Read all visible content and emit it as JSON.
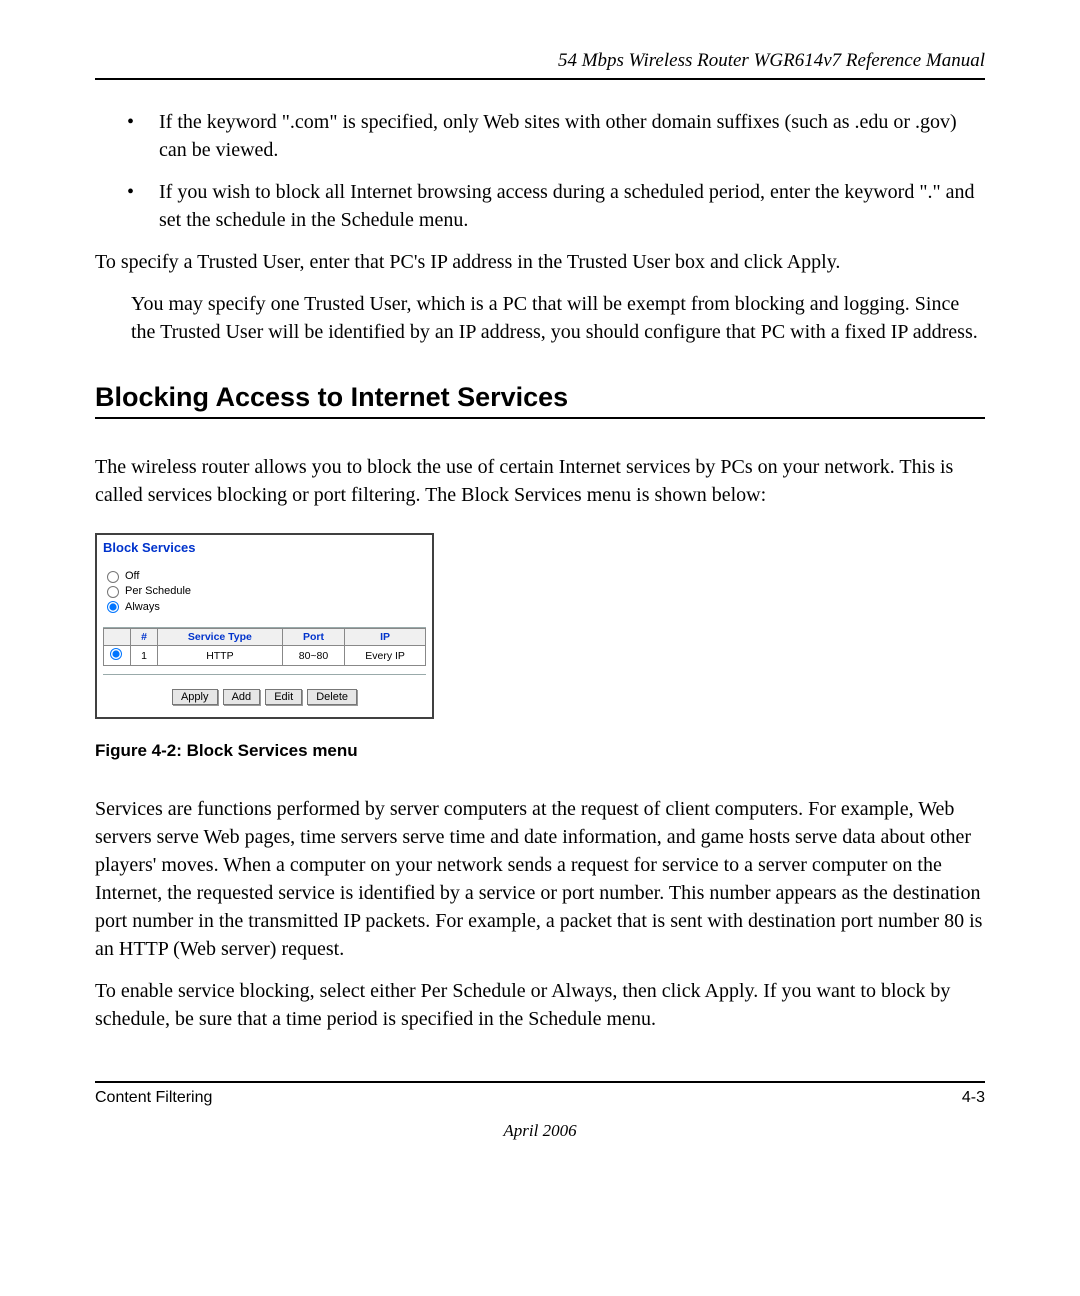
{
  "header": {
    "running_head": "54 Mbps Wireless Router WGR614v7 Reference Manual"
  },
  "bullets": [
    "If the keyword \".com\" is specified, only Web sites with other domain suffixes (such as .edu or .gov) can be viewed.",
    "If you wish to block all Internet browsing access during a scheduled period, enter the keyword \".\" and set the schedule in the Schedule menu."
  ],
  "paras": {
    "trusted_intro": "To specify a Trusted User, enter that PC's IP address in the Trusted User box and click Apply.",
    "trusted_detail": "You may specify one Trusted User, which is a PC that will be exempt from blocking and logging. Since the Trusted User will be identified by an IP address, you should configure that PC with a fixed IP address.",
    "section_heading": "Blocking Access to Internet Services",
    "section_intro": "The wireless router allows you to block the use of certain Internet services by PCs on your network. This is called services blocking or port filtering. The Block Services menu is shown below:",
    "services_para": "Services are functions performed by server computers at the request of client computers. For example, Web servers serve Web pages, time servers serve time and date information, and game hosts serve data about other players' moves. When a computer on your network sends a request for service to a server computer on the Internet, the requested service is identified by a service or port number. This number appears as the destination port number in the transmitted IP packets. For example, a packet that is sent with destination port number 80 is an HTTP (Web server) request.",
    "enable_para": "To enable service blocking, select either Per Schedule or Always, then click Apply. If you want to block by schedule, be sure that a time period is specified in the Schedule menu."
  },
  "screenshot": {
    "title": "Block Services",
    "radios": {
      "off": "Off",
      "per_schedule": "Per Schedule",
      "always": "Always"
    },
    "table": {
      "headers": {
        "num": "#",
        "service_type": "Service Type",
        "port": "Port",
        "ip": "IP"
      },
      "row": {
        "num": "1",
        "service_type": "HTTP",
        "port": "80~80",
        "ip": "Every IP"
      }
    },
    "buttons": {
      "apply": "Apply",
      "add": "Add",
      "edit": "Edit",
      "delete": "Delete"
    }
  },
  "figure_caption": "Figure 4-2:  Block Services menu",
  "footer": {
    "left": "Content Filtering",
    "right": "4-3",
    "date": "April 2006"
  }
}
